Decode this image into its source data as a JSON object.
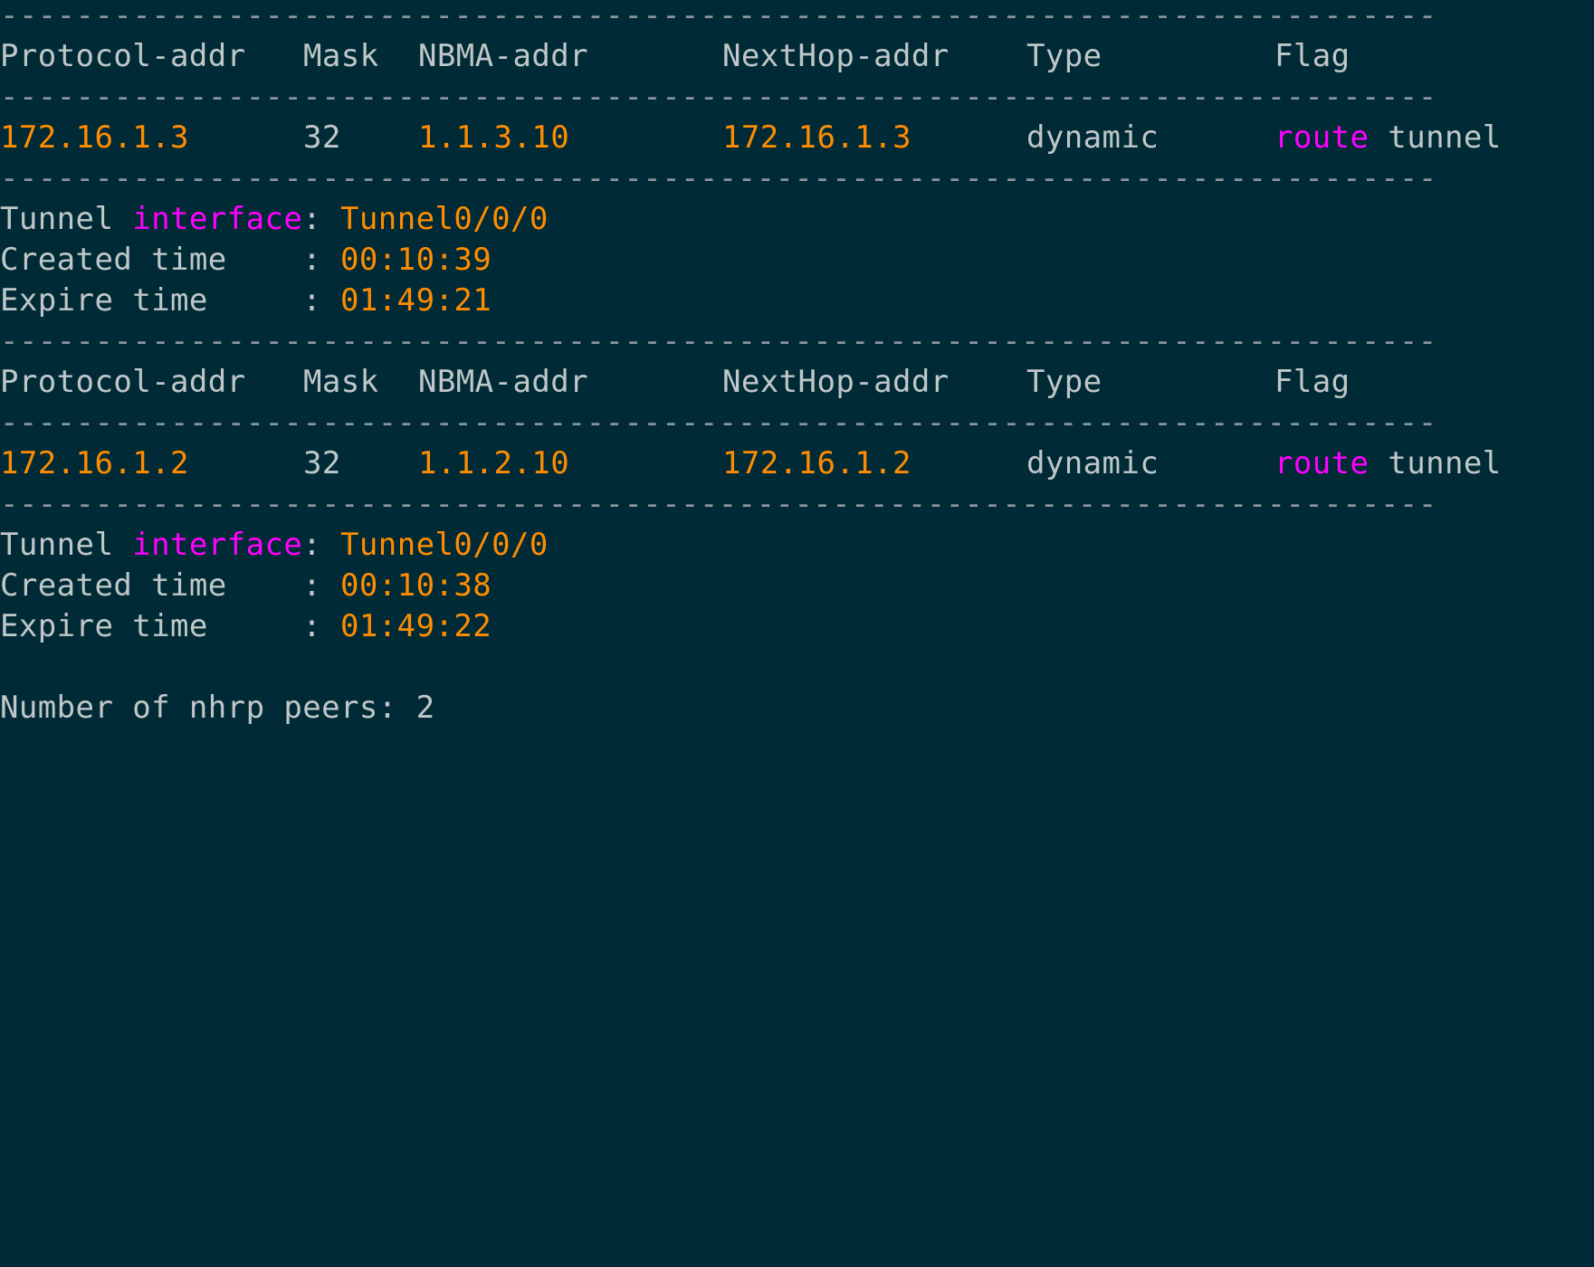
{
  "separator": "----------------------------------------------------------------------------",
  "headers": {
    "protocol": "Protocol-addr",
    "mask": "Mask",
    "nbma": "NBMA-addr",
    "nexthop": "NextHop-addr",
    "type": "Type",
    "flag": "Flag"
  },
  "labels": {
    "tunnel_prefix": "Tunnel ",
    "tunnel_keyword": "interface",
    "tunnel_colon": ": ",
    "created": "Created time    : ",
    "expire": "Expire time     : "
  },
  "peers": [
    {
      "protocol_addr": "172.16.1.3",
      "mask": "32",
      "nbma_addr": "1.1.3.10",
      "nexthop_addr": "172.16.1.3",
      "type": "dynamic",
      "flag_route": "route",
      "flag_tunnel": " tunnel",
      "tunnel_interface": "Tunnel0/0/0",
      "created_time": "00:10:39",
      "expire_time": "01:49:21"
    },
    {
      "protocol_addr": "172.16.1.2",
      "mask": "32",
      "nbma_addr": "1.1.2.10",
      "nexthop_addr": "172.16.1.2",
      "type": "dynamic",
      "flag_route": "route",
      "flag_tunnel": " tunnel",
      "tunnel_interface": "Tunnel0/0/0",
      "created_time": "00:10:38",
      "expire_time": "01:49:22"
    }
  ],
  "summary": {
    "label": "Number of nhrp peers: ",
    "count": "2"
  },
  "colors": {
    "background": "#002b36",
    "text": "#c0c7c8",
    "value": "#ff8c00",
    "keyword": "#ff00ff",
    "separator": "#8a9699"
  }
}
